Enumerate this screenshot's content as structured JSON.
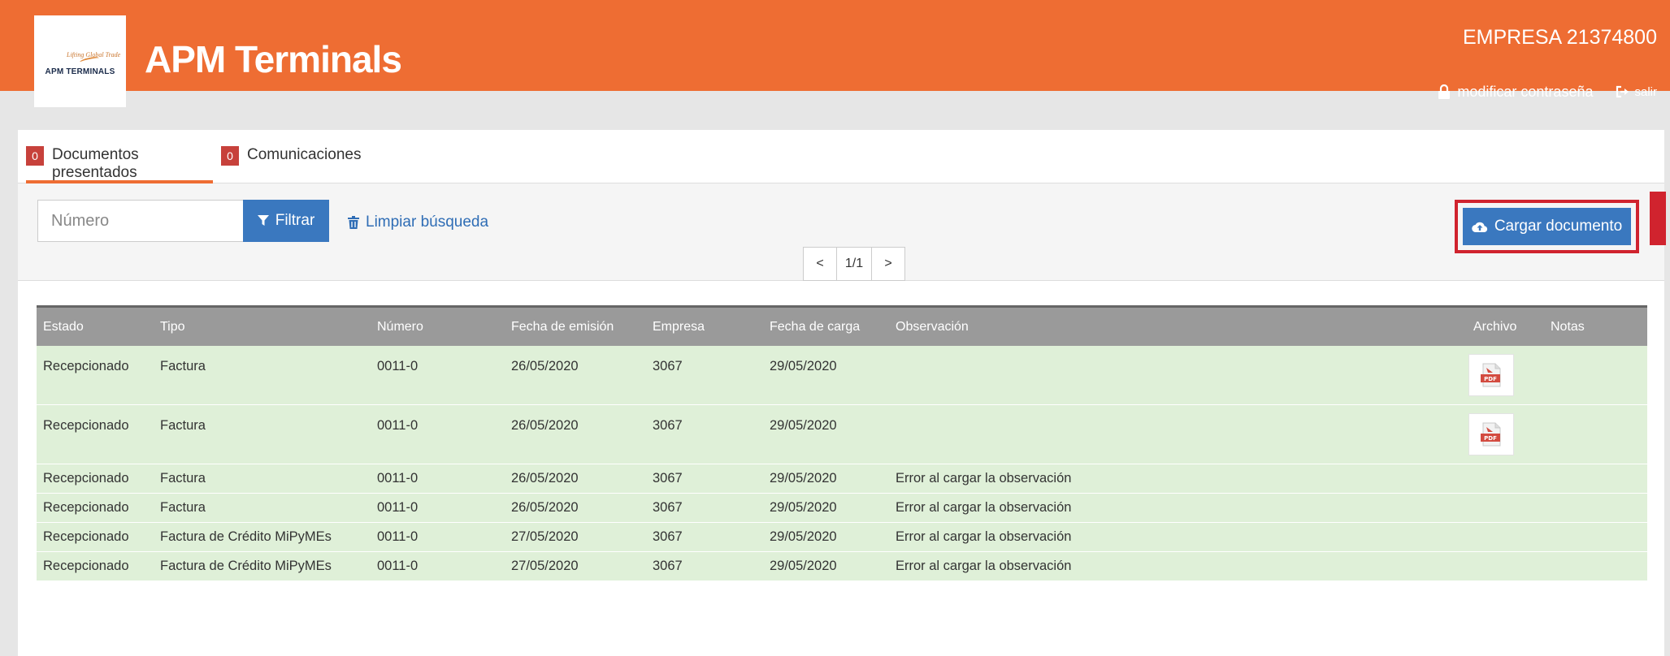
{
  "header": {
    "logo_text": "APM TERMINALS",
    "logo_tagline": "Lifting Global Trade",
    "title": "APM Terminals",
    "company": "EMPRESA 21374800",
    "change_password": "modificar contraseña",
    "logout": "salir"
  },
  "tabs": [
    {
      "label": "Documentos presentados",
      "count": "0",
      "active": true
    },
    {
      "label": "Comunicaciones",
      "count": "0",
      "active": false
    }
  ],
  "toolbar": {
    "search_placeholder": "Número",
    "filter_label": "Filtrar",
    "clear_label": "Limpiar búsqueda",
    "upload_label": "Cargar documento",
    "pager": {
      "prev": "<",
      "current": "1/1",
      "next": ">"
    }
  },
  "table": {
    "columns": [
      "Estado",
      "Tipo",
      "Número",
      "Fecha de emisión",
      "Empresa",
      "Fecha de carga",
      "Observación",
      "Archivo",
      "Notas"
    ],
    "rows": [
      {
        "estado": "Recepcionado",
        "tipo": "Factura",
        "numero": "0011-0",
        "fecha_emision": "26/05/2020",
        "empresa": "3067",
        "fecha_carga": "29/05/2020",
        "observacion": "",
        "archivo": "pdf-icon"
      },
      {
        "estado": "Recepcionado",
        "tipo": "Factura",
        "numero": "0011-0",
        "fecha_emision": "26/05/2020",
        "empresa": "3067",
        "fecha_carga": "29/05/2020",
        "observacion": "",
        "archivo": "pdf-icon"
      },
      {
        "estado": "Recepcionado",
        "tipo": "Factura",
        "numero": "0011-0",
        "fecha_emision": "26/05/2020",
        "empresa": "3067",
        "fecha_carga": "29/05/2020",
        "observacion": "Error al cargar la observación",
        "archivo": ""
      },
      {
        "estado": "Recepcionado",
        "tipo": "Factura",
        "numero": "0011-0",
        "fecha_emision": "26/05/2020",
        "empresa": "3067",
        "fecha_carga": "29/05/2020",
        "observacion": "Error al cargar la observación",
        "archivo": ""
      },
      {
        "estado": "Recepcionado",
        "tipo": "Factura de Crédito MiPyMEs",
        "numero": "0011-0",
        "fecha_emision": "27/05/2020",
        "empresa": "3067",
        "fecha_carga": "29/05/2020",
        "observacion": "Error al cargar la observación",
        "archivo": ""
      },
      {
        "estado": "Recepcionado",
        "tipo": "Factura de Crédito MiPyMEs",
        "numero": "0011-0",
        "fecha_emision": "27/05/2020",
        "empresa": "3067",
        "fecha_carga": "29/05/2020",
        "observacion": "Error al cargar la observación",
        "archivo": ""
      }
    ]
  },
  "colors": {
    "header_bg": "#ee6d33",
    "primary_button": "#3a78bf",
    "badge": "#c7413b",
    "row_bg": "#dff0d8",
    "highlight": "#d0232e"
  }
}
